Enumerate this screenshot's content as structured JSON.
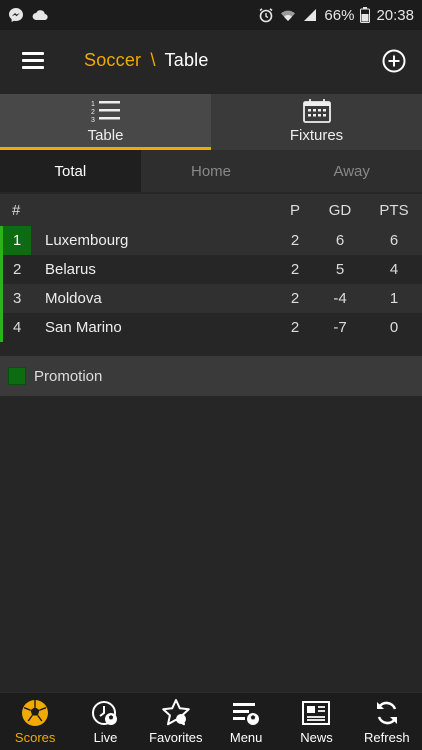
{
  "status_bar": {
    "battery": "66%",
    "time": "20:38"
  },
  "app_bar": {
    "sport": "Soccer",
    "separator": "\\",
    "section": "Table"
  },
  "top_tabs": [
    {
      "label": "Table",
      "icon": "list-numbered-icon",
      "active": true
    },
    {
      "label": "Fixtures",
      "icon": "calendar-icon",
      "active": false
    }
  ],
  "sub_tabs": [
    {
      "label": "Total",
      "active": true
    },
    {
      "label": "Home",
      "active": false
    },
    {
      "label": "Away",
      "active": false
    }
  ],
  "table": {
    "headers": {
      "rank": "#",
      "p": "P",
      "gd": "GD",
      "pts": "PTS"
    },
    "rows": [
      {
        "rank": "1",
        "team": "Luxembourg",
        "p": "2",
        "gd": "6",
        "pts": "6"
      },
      {
        "rank": "2",
        "team": "Belarus",
        "p": "2",
        "gd": "5",
        "pts": "4"
      },
      {
        "rank": "3",
        "team": "Moldova",
        "p": "2",
        "gd": "-4",
        "pts": "1"
      },
      {
        "rank": "4",
        "team": "San Marino",
        "p": "2",
        "gd": "-7",
        "pts": "0"
      }
    ]
  },
  "legend": {
    "label": "Promotion",
    "color": "#0d6b12"
  },
  "bottom_nav": [
    {
      "label": "Scores",
      "icon": "soccer-ball-icon",
      "active": true
    },
    {
      "label": "Live",
      "icon": "live-clock-icon",
      "active": false
    },
    {
      "label": "Favorites",
      "icon": "star-icon",
      "active": false
    },
    {
      "label": "Menu",
      "icon": "menu-ball-icon",
      "active": false
    },
    {
      "label": "News",
      "icon": "newspaper-icon",
      "active": false
    },
    {
      "label": "Refresh",
      "icon": "refresh-icon",
      "active": false
    }
  ],
  "colors": {
    "accent": "#f2a900",
    "promotion": "#2bb31a"
  }
}
